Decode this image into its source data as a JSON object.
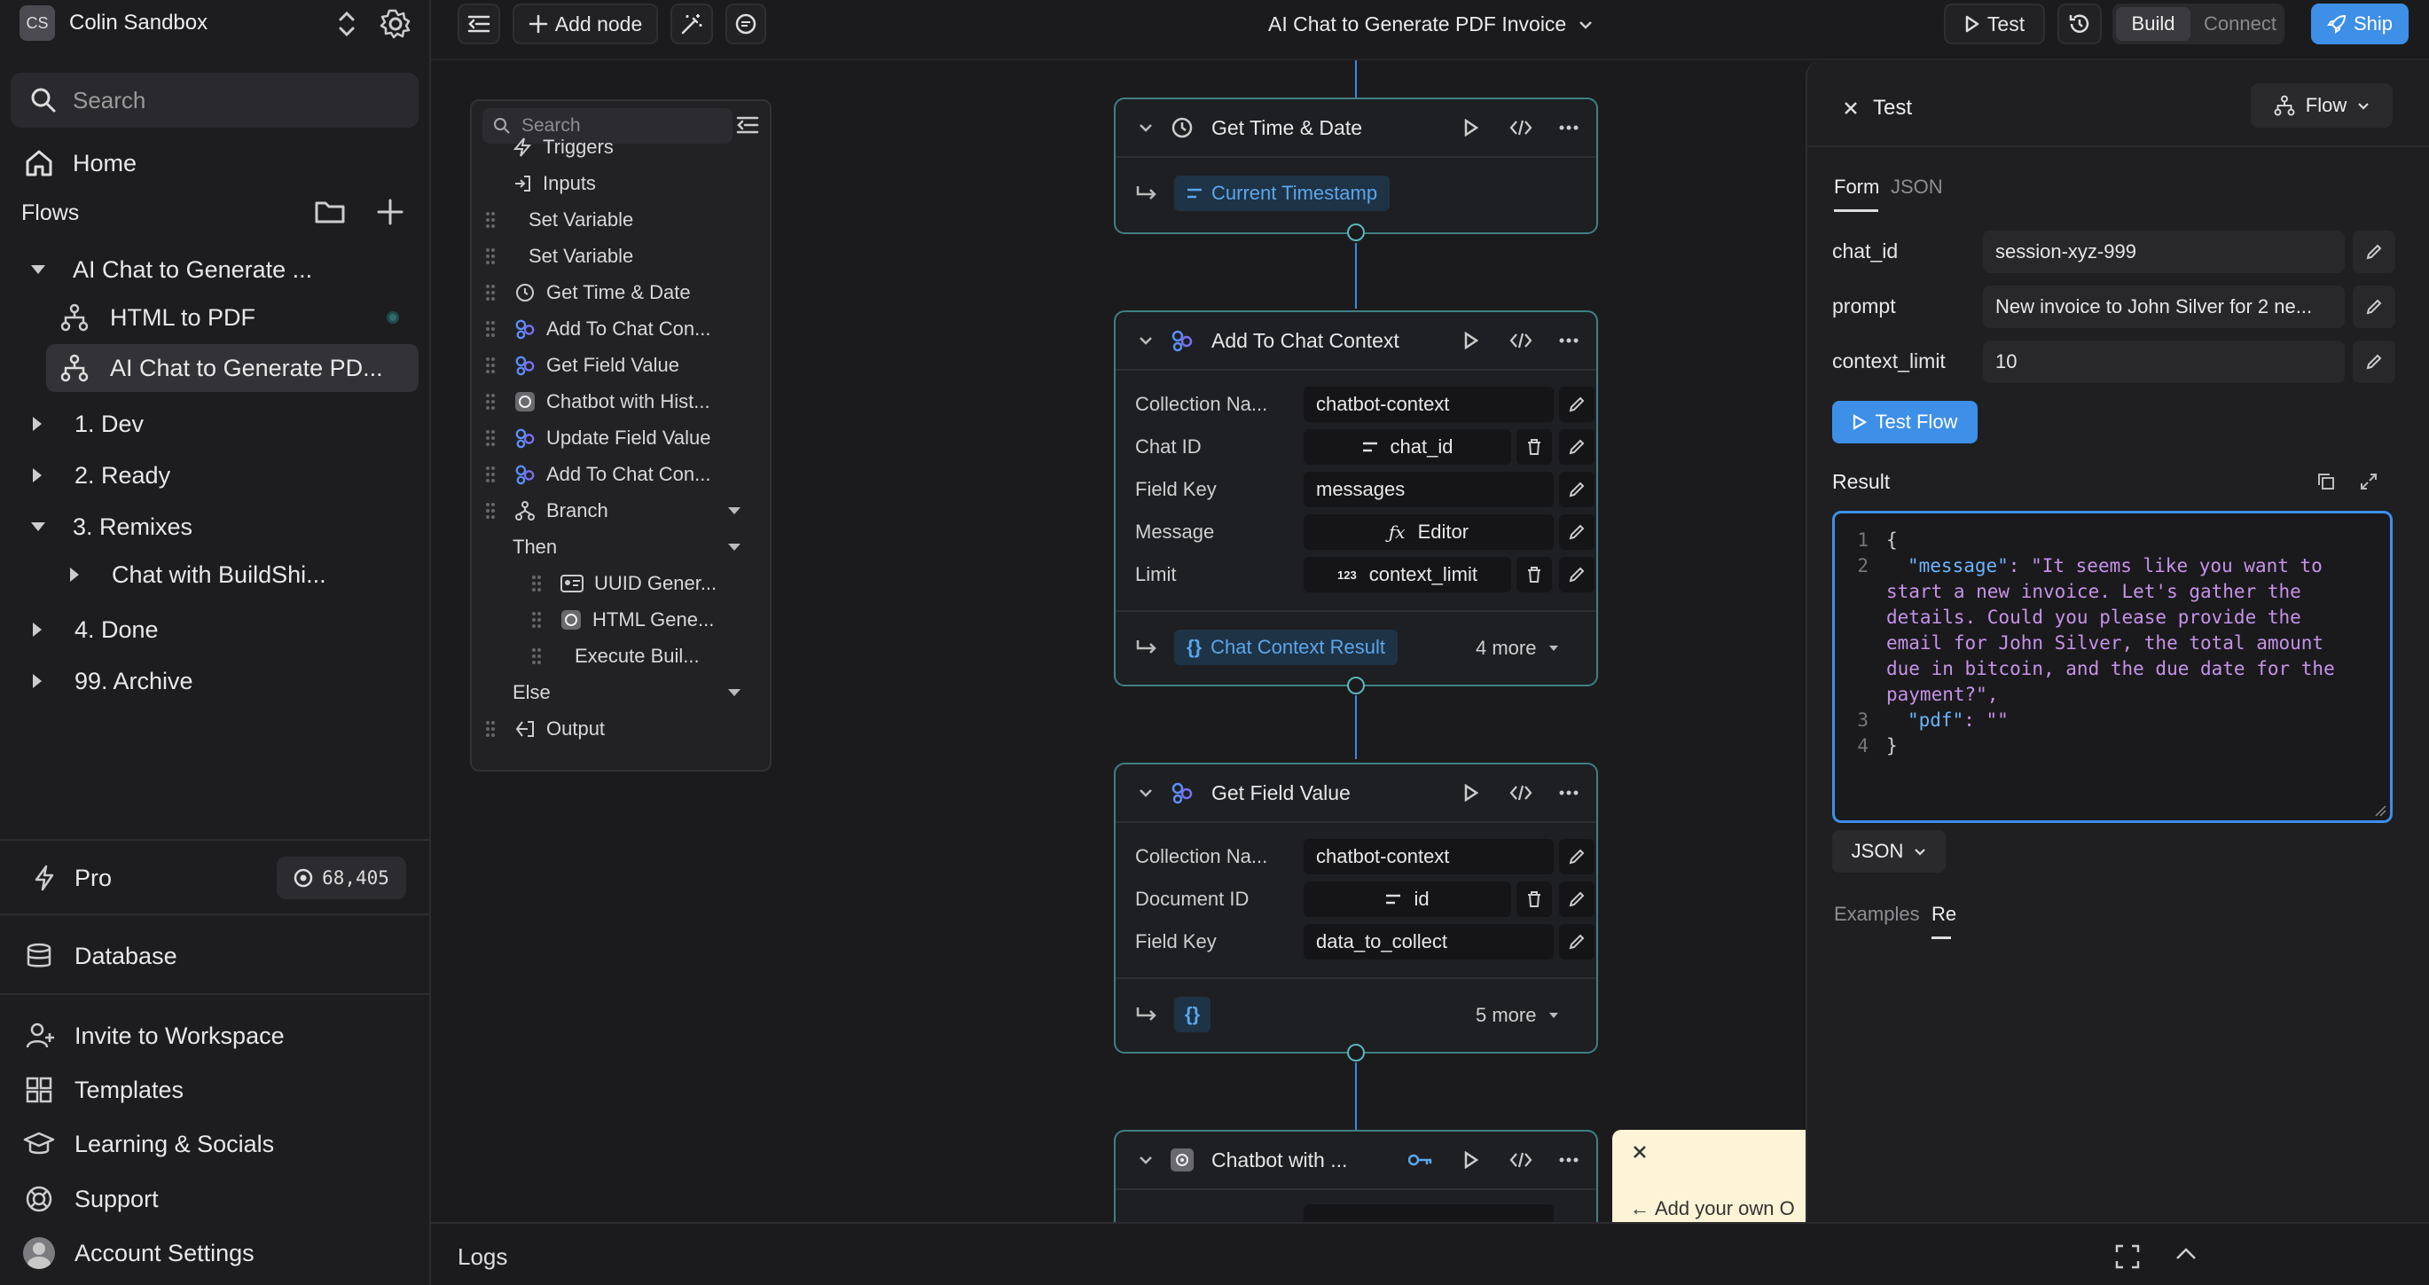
{
  "workspace": {
    "initials": "CS",
    "name": "Colin Sandbox"
  },
  "sidebar": {
    "search_placeholder": "Search",
    "home": "Home",
    "flows_label": "Flows",
    "tree": [
      {
        "label": "AI Chat to Generate ...",
        "level": 0,
        "expanded": true
      },
      {
        "label": "HTML to PDF",
        "level": 1,
        "status": "active"
      },
      {
        "label": "AI Chat to Generate PD...",
        "level": 1,
        "selected": true
      },
      {
        "label": "1. Dev",
        "level": 0,
        "expanded": false
      },
      {
        "label": "2. Ready",
        "level": 0,
        "expanded": false
      },
      {
        "label": "3. Remixes",
        "level": 0,
        "expanded": true
      },
      {
        "label": "Chat with BuildShi...",
        "level": 1,
        "expanded": false
      },
      {
        "label": "4. Done",
        "level": 0,
        "expanded": false
      },
      {
        "label": "99. Archive",
        "level": 0,
        "expanded": false
      }
    ],
    "plan": "Pro",
    "credits": "68,405",
    "database": "Database",
    "invite": "Invite to Workspace",
    "templates": "Templates",
    "learning": "Learning & Socials",
    "support": "Support",
    "account": "Account Settings"
  },
  "toolbar": {
    "add_node": "Add node",
    "flow_title": "AI Chat to Generate PDF Invoice",
    "test": "Test",
    "build": "Build",
    "connect": "Connect",
    "ship": "Ship"
  },
  "palette": {
    "search_placeholder": "Search",
    "items": {
      "triggers": "Triggers",
      "inputs": "Inputs",
      "set_var_1": "Set Variable",
      "set_var_2": "Set Variable",
      "get_time": "Get Time & Date",
      "add_ctx_1": "Add To Chat Con...",
      "get_field": "Get Field Value",
      "chatbot": "Chatbot with Hist...",
      "update_field": "Update Field Value",
      "add_ctx_2": "Add To Chat Con...",
      "branch": "Branch",
      "then": "Then",
      "uuid": "UUID Gener...",
      "html_gen": "HTML Gene...",
      "exec_build": "Execute Buil...",
      "else": "Else",
      "output": "Output"
    }
  },
  "nodes": {
    "time": {
      "title": "Get Time & Date",
      "output": "Current Timestamp"
    },
    "ctx": {
      "title": "Add To Chat Context",
      "fields": {
        "collection_label": "Collection Na...",
        "collection_value": "chatbot-context",
        "chatid_label": "Chat ID",
        "chatid_value": "chat_id",
        "fieldkey_label": "Field Key",
        "fieldkey_value": "messages",
        "message_label": "Message",
        "message_value": "Editor",
        "limit_label": "Limit",
        "limit_value": "context_limit"
      },
      "output": "Chat Context Result",
      "more": "4 more"
    },
    "getfield": {
      "title": "Get Field Value",
      "fields": {
        "collection_label": "Collection Na...",
        "collection_value": "chatbot-context",
        "docid_label": "Document ID",
        "docid_value": "id",
        "fieldkey_label": "Field Key",
        "fieldkey_value": "data_to_collect"
      },
      "more": "5 more"
    },
    "chatbot": {
      "title": "Chatbot with ..."
    },
    "toast": "Add your own O"
  },
  "test_panel": {
    "title": "Test",
    "mode": "Flow",
    "tabs": [
      "Form",
      "JSON"
    ],
    "inputs": [
      {
        "label": "chat_id",
        "value": "session-xyz-999"
      },
      {
        "label": "prompt",
        "value": "New invoice to John Silver for 2 ne..."
      },
      {
        "label": "context_limit",
        "value": "10"
      }
    ],
    "run_button": "Test Flow",
    "result_label": "Result",
    "result_lines": [
      {
        "n": "1",
        "text": "{"
      },
      {
        "n": "2",
        "key": "\"message\"",
        "text": ": \"It seems like you want to"
      },
      {
        "n": "",
        "text": "start a new invoice. Let's gather the"
      },
      {
        "n": "",
        "text": "details. Could you please provide the"
      },
      {
        "n": "",
        "text": "email for John Silver, the total amount"
      },
      {
        "n": "",
        "text": "due in bitcoin, and the due date for the"
      },
      {
        "n": "",
        "text": "payment?\","
      },
      {
        "n": "3",
        "key": "\"pdf\"",
        "text": ": \"\""
      },
      {
        "n": "4",
        "text": "}"
      }
    ],
    "format": "JSON",
    "bottom_tabs": [
      "Examples",
      "Re"
    ]
  },
  "logs": {
    "label": "Logs"
  },
  "colors": {
    "accent": "#3d8fe8",
    "node_border": "#3f7f82",
    "json_string": "#c792ea",
    "json_key": "#6cb4ff"
  }
}
